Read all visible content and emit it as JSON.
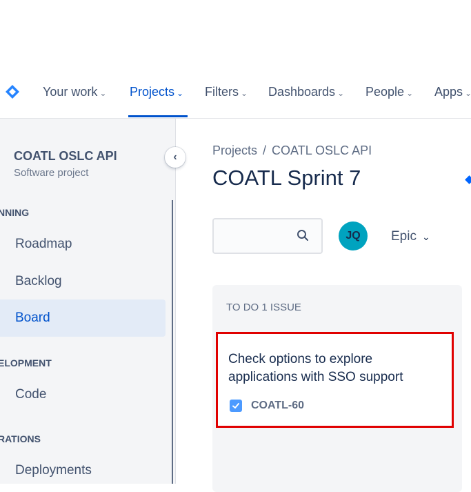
{
  "nav": {
    "items": [
      {
        "label": "Your work",
        "active": false
      },
      {
        "label": "Projects",
        "active": true
      },
      {
        "label": "Filters",
        "active": false
      },
      {
        "label": "Dashboards",
        "active": false
      },
      {
        "label": "People",
        "active": false
      },
      {
        "label": "Apps",
        "active": false
      }
    ],
    "chevron": "⌄"
  },
  "sidebar": {
    "project_name": "COATL OSLC API",
    "project_type": "Software project",
    "collapse_icon": "‹",
    "sections": {
      "planning": "NNING",
      "development": "ELOPMENT",
      "operations": "RATIONS"
    },
    "items": [
      "Roadmap",
      "Backlog",
      "Board",
      "Code",
      "Deployments"
    ]
  },
  "main": {
    "breadcrumb": {
      "root": "Projects",
      "sep": "/",
      "current": "COATL OSLC API"
    },
    "title": "COATL Sprint 7",
    "avatar_initials": "JQ",
    "epic_label": "Epic",
    "epic_chevron": "⌄"
  },
  "board": {
    "column_header": "TO DO 1 ISSUE",
    "card": {
      "summary": "Check options to explore applications with SSO support",
      "key": "COATL-60"
    }
  },
  "colors": {
    "accent": "#0052cc",
    "highlight_border": "#e00000",
    "avatar": "#00a3bf",
    "task_icon": "#4c9aff"
  }
}
